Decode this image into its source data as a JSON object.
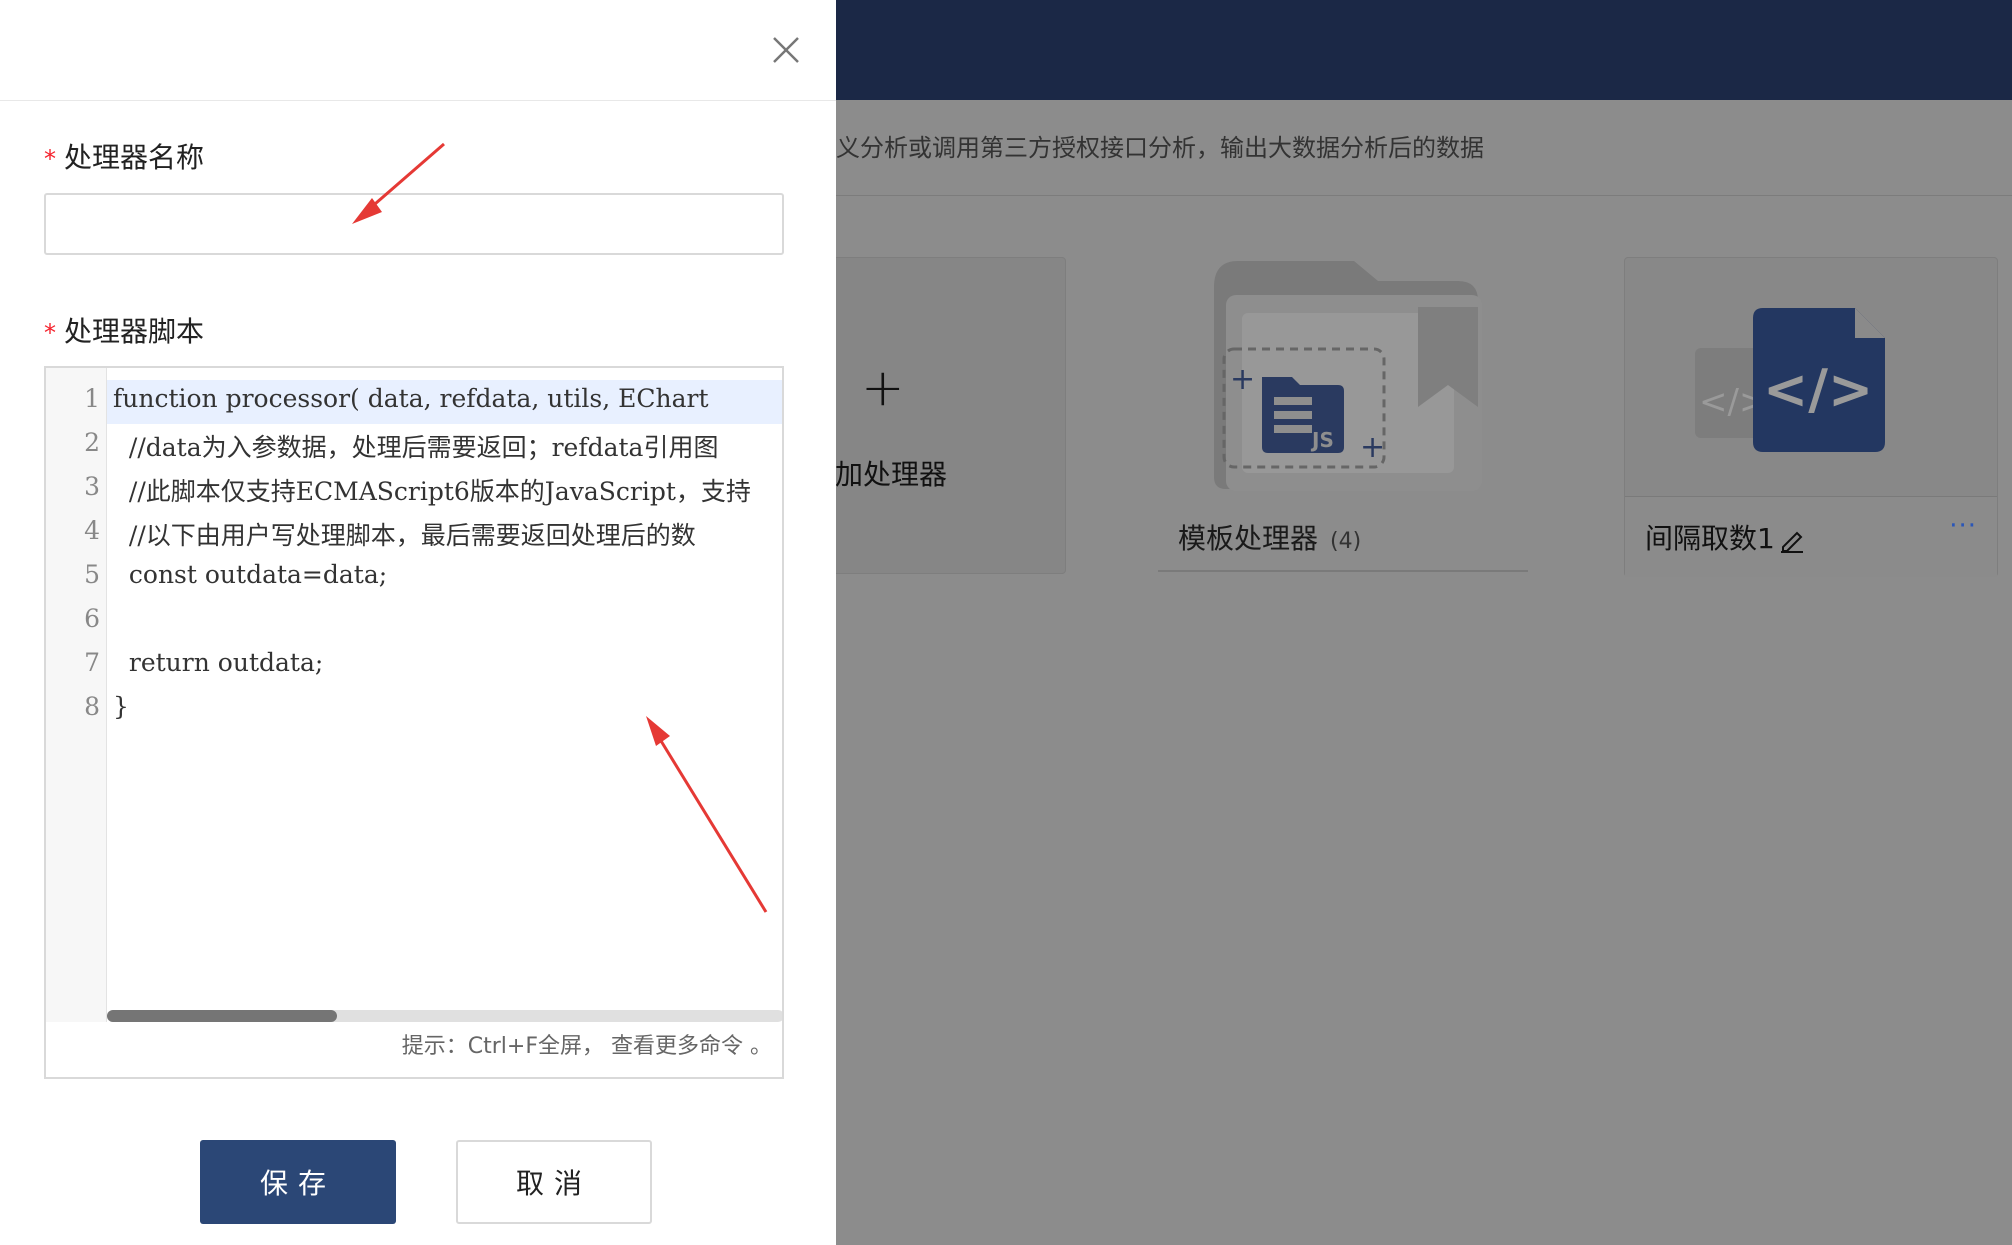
{
  "background": {
    "description": "义分析或调用第三方授权接口分析，输出大数据分析后的数据",
    "add_card": {
      "plus": "+",
      "label": "加处理器"
    },
    "template_card": {
      "label": "模板处理器",
      "count": "(4)"
    },
    "interval_card": {
      "label": "间隔取数1",
      "more": "···"
    }
  },
  "drawer": {
    "close_icon": "close-icon",
    "name_field": {
      "label": "处理器名称",
      "required_mark": "*",
      "value": ""
    },
    "script_field": {
      "label": "处理器脚本",
      "required_mark": "*"
    },
    "editor": {
      "line_numbers": [
        "1",
        "2",
        "3",
        "4",
        "5",
        "6",
        "7",
        "8"
      ],
      "lines": [
        "function processor( data, refdata, utils, EChart",
        "  //data为入参数据，处理后需要返回；refdata引用图",
        "  //此脚本仅支持ECMAScript6版本的JavaScript，支持",
        "  //以下由用户写处理脚本，最后需要返回处理后的数",
        "  const outdata=data;",
        "",
        "  return outdata;",
        "}"
      ],
      "hint": "提示：Ctrl+F全屏， 查看更多命令 。"
    },
    "buttons": {
      "save": "保存",
      "cancel": "取消"
    }
  },
  "colors": {
    "header": "#1b2846",
    "primary": "#2b4776",
    "required": "#f5222d",
    "annotation_arrow": "#e53935",
    "link": "#2a56b8"
  }
}
